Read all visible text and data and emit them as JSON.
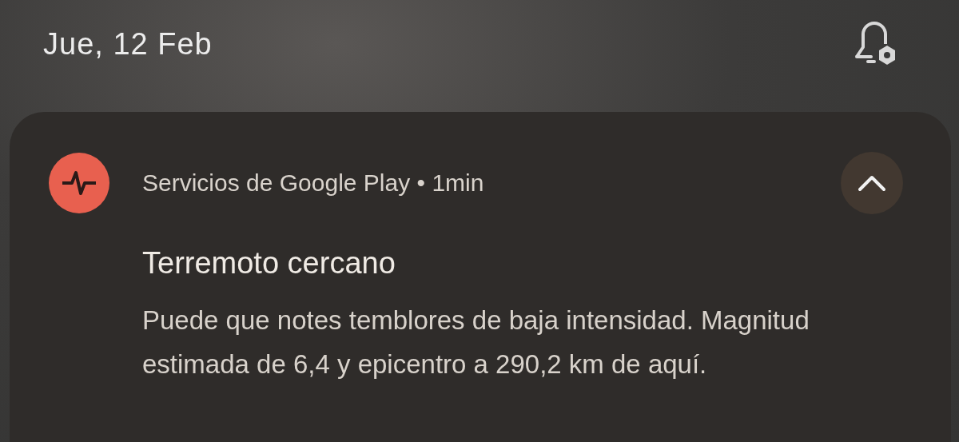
{
  "status": {
    "date": "Jue, 12 Feb"
  },
  "notification": {
    "app": "Servicios de Google Play",
    "separator": "•",
    "time": "1min",
    "expanded": true,
    "title": "Terremoto cercano",
    "body": "Puede que notes temblores de baja intensidad. Magnitud estimada de 6,4 y epicentro a 290,2 km de aquí."
  }
}
